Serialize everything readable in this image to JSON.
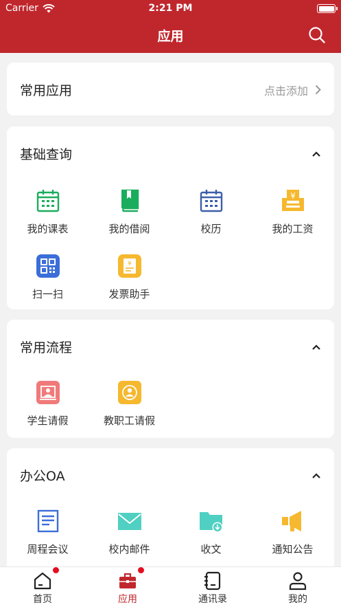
{
  "status_bar": {
    "carrier": "Carrier",
    "time": "2:21 PM"
  },
  "nav": {
    "title": "应用"
  },
  "common_apps": {
    "title": "常用应用",
    "add_text": "点击添加"
  },
  "basic_query": {
    "title": "基础查询",
    "items": [
      "我的课表",
      "我的借阅",
      "校历",
      "我的工资",
      "扫一扫",
      "发票助手"
    ]
  },
  "common_process": {
    "title": "常用流程",
    "items": [
      "学生请假",
      "教职工请假"
    ]
  },
  "office_oa": {
    "title": "办公OA",
    "items": [
      "周程会议",
      "校内邮件",
      "收文",
      "通知公告"
    ]
  },
  "tabs": [
    {
      "label": "首页",
      "badge": true
    },
    {
      "label": "应用",
      "badge": true,
      "active": true
    },
    {
      "label": "通讯录",
      "badge": false
    },
    {
      "label": "我的",
      "badge": false
    }
  ],
  "colors": {
    "brand_red": "#c0272d",
    "green": "#1aad5d",
    "blue": "#3b6ed8",
    "yellow": "#f5b82e",
    "teal": "#4fd0c2",
    "pink": "#f26b6b"
  }
}
